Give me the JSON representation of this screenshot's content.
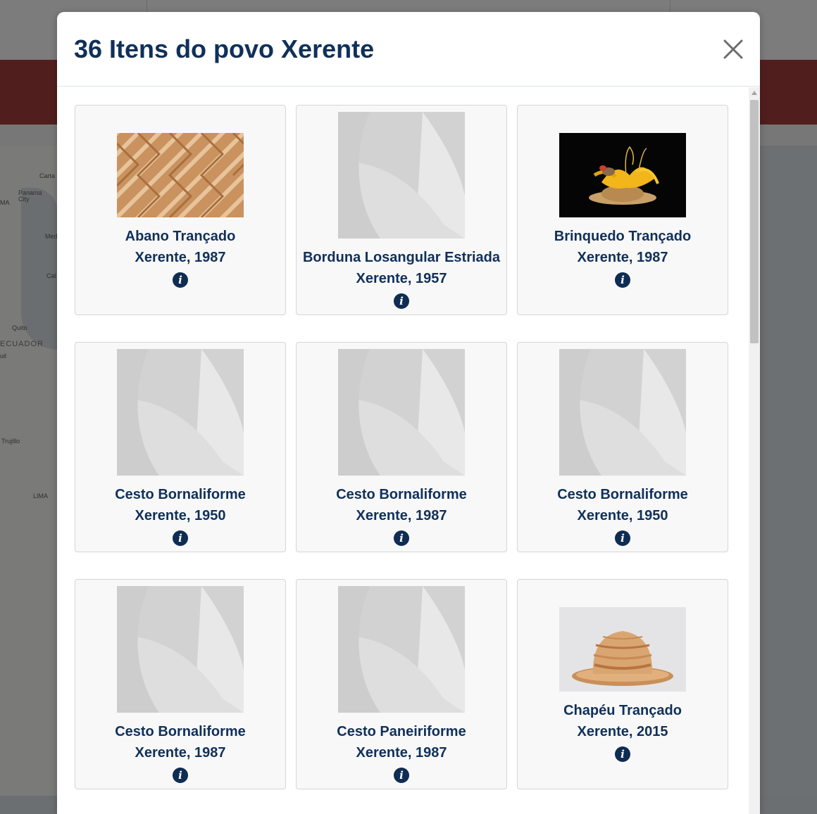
{
  "background": {
    "map_labels": [
      "Carta",
      "Panama City",
      "MA",
      "Med",
      "Cal",
      "Quito",
      "ECUADOR",
      "uil",
      "Trujillo",
      "LIMA"
    ]
  },
  "modal": {
    "title": "36 Itens do povo Xerente",
    "close_icon": "close-icon",
    "info_label": "i",
    "items": [
      {
        "name": "Abano Trançado",
        "subtitle": "Xerente, 1987",
        "image": "woven-fan-photo"
      },
      {
        "name": "Borduna Losangular Estriada",
        "subtitle": "Xerente, 1957",
        "image": "placeholder"
      },
      {
        "name": "Brinquedo Trançado",
        "subtitle": "Xerente, 1987",
        "image": "feathered-toy-photo"
      },
      {
        "name": "Cesto Bornaliforme",
        "subtitle": "Xerente, 1950",
        "image": "placeholder"
      },
      {
        "name": "Cesto Bornaliforme",
        "subtitle": "Xerente, 1987",
        "image": "placeholder"
      },
      {
        "name": "Cesto Bornaliforme",
        "subtitle": "Xerente, 1950",
        "image": "placeholder"
      },
      {
        "name": "Cesto Bornaliforme",
        "subtitle": "Xerente, 1987",
        "image": "placeholder"
      },
      {
        "name": "Cesto Paneiriforme",
        "subtitle": "Xerente, 1987",
        "image": "placeholder"
      },
      {
        "name": "Chapéu Trançado",
        "subtitle": "Xerente, 2015",
        "image": "woven-hat-photo"
      }
    ]
  }
}
